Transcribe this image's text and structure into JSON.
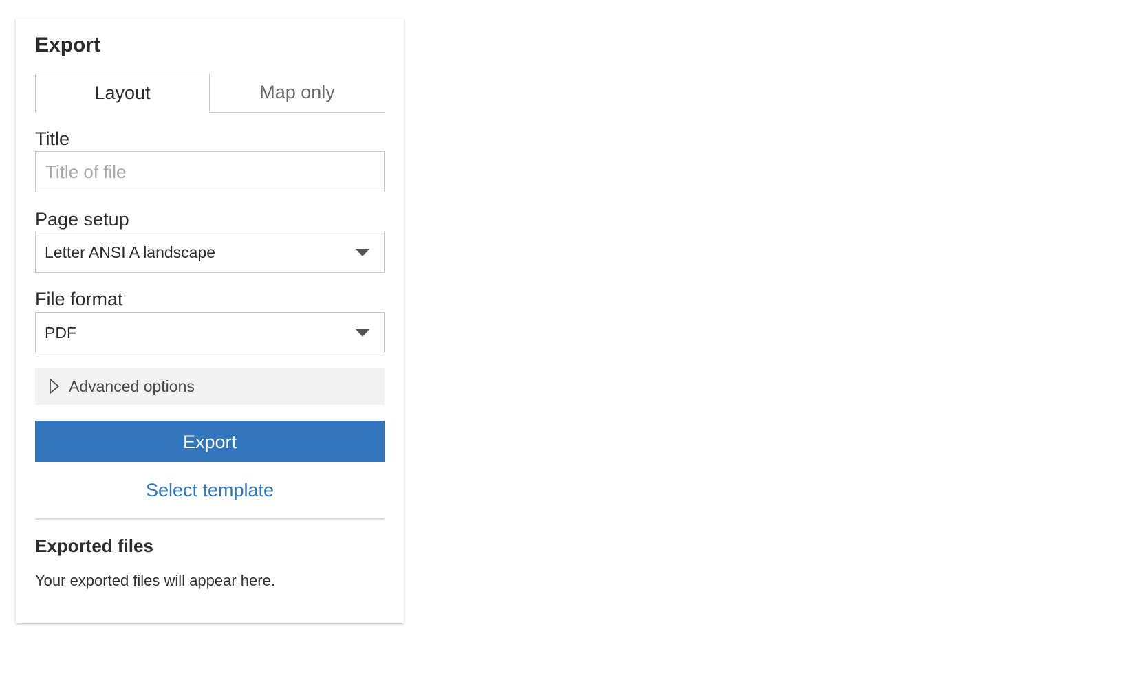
{
  "panel": {
    "title": "Export"
  },
  "tabs": [
    {
      "label": "Layout",
      "active": true
    },
    {
      "label": "Map only",
      "active": false
    }
  ],
  "title_field": {
    "label": "Title",
    "value": "",
    "placeholder": "Title of file"
  },
  "page_setup": {
    "label": "Page setup",
    "selected": "Letter ANSI A landscape"
  },
  "file_format": {
    "label": "File format",
    "selected": "PDF"
  },
  "advanced": {
    "label": "Advanced options",
    "icon": "chevron-right-outline-icon"
  },
  "actions": {
    "export_label": "Export",
    "select_template_label": "Select template"
  },
  "exported_files": {
    "title": "Exported files",
    "empty_message": "Your exported files will appear here."
  },
  "colors": {
    "primary_button": "#3277bd",
    "link": "#2e76bd",
    "advanced_bg": "#f2f2f2",
    "border": "#c9c9c9"
  }
}
